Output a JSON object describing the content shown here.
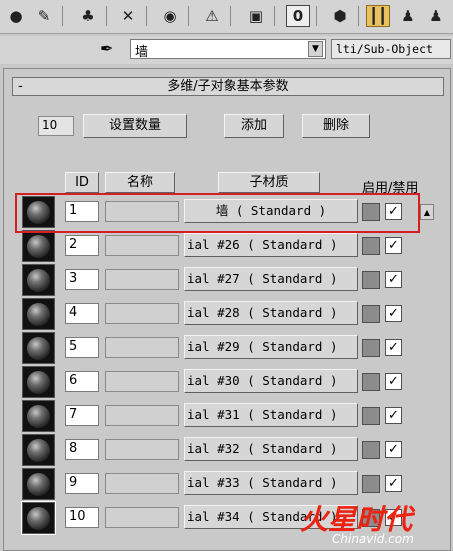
{
  "toolbar": {
    "icons": [
      "get-material-icon",
      "put-to-scene-icon",
      "assign-material-icon",
      "reset-icon",
      "make-copy-icon",
      "make-unique-icon",
      "put-to-library-icon",
      "material-id-channel-icon",
      "show-map-icon",
      "show-end-result-icon",
      "go-to-parent-icon",
      "go-forward-sibling-icon"
    ],
    "channel_label": "0"
  },
  "material": {
    "name": "墙",
    "type": "lti/Sub-Object"
  },
  "panel": {
    "rollout_title": "多维/子对象基本参数",
    "rollout_toggle": "-",
    "count": "10",
    "set_count_label": "设置数量",
    "add_label": "添加",
    "delete_label": "删除"
  },
  "headers": {
    "id": "ID",
    "name": "名称",
    "submaterial": "子材质",
    "on_off": "启用/禁用"
  },
  "rows": [
    {
      "id": "1",
      "name": "",
      "material": "墙  ( Standard )",
      "enabled": true
    },
    {
      "id": "2",
      "name": "",
      "material": "ial #26  ( Standard )",
      "enabled": true
    },
    {
      "id": "3",
      "name": "",
      "material": "ial #27  ( Standard )",
      "enabled": true
    },
    {
      "id": "4",
      "name": "",
      "material": "ial #28  ( Standard )",
      "enabled": true
    },
    {
      "id": "5",
      "name": "",
      "material": "ial #29  ( Standard )",
      "enabled": true
    },
    {
      "id": "6",
      "name": "",
      "material": "ial #30  ( Standard )",
      "enabled": true
    },
    {
      "id": "7",
      "name": "",
      "material": "ial #31  ( Standard )",
      "enabled": true
    },
    {
      "id": "8",
      "name": "",
      "material": "ial #32  ( Standard )",
      "enabled": true
    },
    {
      "id": "9",
      "name": "",
      "material": "ial #33  ( Standard )",
      "enabled": true
    },
    {
      "id": "10",
      "name": "",
      "material": "ial #34  ( Standard )",
      "enabled": true
    }
  ],
  "checkmark": "✓",
  "watermark": {
    "logo": "火星时代",
    "url": "Chinavid.com"
  },
  "colors": {
    "highlight": "#d42020",
    "background": "#c8c8c8"
  }
}
